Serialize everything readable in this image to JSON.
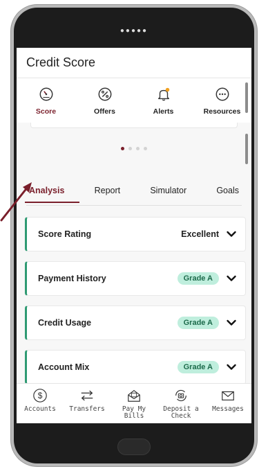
{
  "app": {
    "title": "Credit Score"
  },
  "top_nav": [
    {
      "label": "Score",
      "icon": "gauge-icon",
      "active": true
    },
    {
      "label": "Offers",
      "icon": "percent-icon",
      "active": false
    },
    {
      "label": "Alerts",
      "icon": "bell-icon",
      "active": false
    },
    {
      "label": "Resources",
      "icon": "more-icon",
      "active": false
    }
  ],
  "carousel": {
    "pages": 4,
    "current": 1
  },
  "tabs": [
    {
      "label": "Analysis",
      "active": true
    },
    {
      "label": "Report",
      "active": false
    },
    {
      "label": "Simulator",
      "active": false
    },
    {
      "label": "Goals",
      "active": false
    }
  ],
  "rows": [
    {
      "label": "Score Rating",
      "value": "Excellent"
    },
    {
      "label": "Payment History",
      "badge": "Grade A"
    },
    {
      "label": "Credit Usage",
      "badge": "Grade A"
    },
    {
      "label": "Account Mix",
      "badge": "Grade A"
    }
  ],
  "bottom_nav": [
    {
      "label": "Accounts",
      "icon": "dollar-circle-icon"
    },
    {
      "label": "Transfers",
      "icon": "swap-arrows-icon"
    },
    {
      "label": "Pay My Bills",
      "icon": "envelope-bill-icon"
    },
    {
      "label": "Deposit a Check",
      "icon": "camera-deposit-icon"
    },
    {
      "label": "Messages",
      "icon": "mail-icon"
    }
  ],
  "colors": {
    "brand": "#7a1f2b",
    "accent_green": "#2e9a72",
    "badge_bg": "#bfeedd",
    "alert_dot": "#f0a020"
  }
}
